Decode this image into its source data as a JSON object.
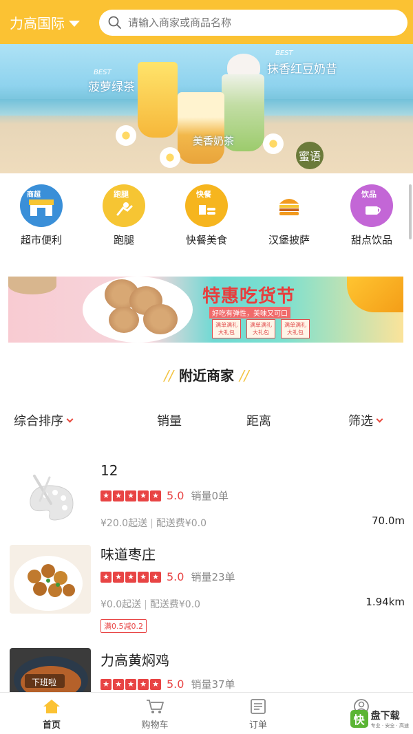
{
  "header": {
    "city": "力高国际",
    "search_placeholder": "请输入商家或商品名称"
  },
  "banner": {
    "texts": [
      "菠萝绿茶",
      "抹香红豆奶昔",
      "美香奶茶"
    ],
    "best_label": "BEST",
    "stamp": "蜜语"
  },
  "categories": [
    {
      "label": "超市便利",
      "icon": "store-icon",
      "tag": "商超",
      "color": "#3a8fd8"
    },
    {
      "label": "跑腿",
      "icon": "runner-icon",
      "tag": "跑腿",
      "color": "#f6c533"
    },
    {
      "label": "快餐美食",
      "icon": "fastfood-icon",
      "tag": "快餐",
      "color": "#f6b51e"
    },
    {
      "label": "汉堡披萨",
      "icon": "burger-icon",
      "tag": "",
      "color": "#f29a1e"
    },
    {
      "label": "甜点饮品",
      "icon": "drink-icon",
      "tag": "饮品",
      "color": "#c366d6"
    }
  ],
  "promo": {
    "title": "特惠吃货节",
    "subtitle": "好吃有弹性，美味又可口",
    "chips": [
      "满单满礼 大礼包",
      "满单满礼 大礼包",
      "满单满礼 大礼包"
    ]
  },
  "section": {
    "title": "附近商家",
    "decor": "//"
  },
  "sort": {
    "overall": "综合排序",
    "sales": "销量",
    "distance": "距离",
    "filter": "筛选"
  },
  "shops": [
    {
      "name": "12",
      "score": "5.0",
      "sales": "销量0单",
      "min_order": "¥20.0起送",
      "delivery_fee": "配送费¥0.0",
      "distance": "70.0m",
      "thumb": "palette-placeholder",
      "promo": ""
    },
    {
      "name": "味道枣庄",
      "score": "5.0",
      "sales": "销量23单",
      "min_order": "¥0.0起送",
      "delivery_fee": "配送费¥0.0",
      "distance": "1.94km",
      "thumb": "meatball-dish",
      "promo": "满0.5减0.2"
    },
    {
      "name": "力高黄焖鸡",
      "score": "5.0",
      "sales": "销量37单",
      "min_order": "",
      "delivery_fee": "",
      "distance": "",
      "thumb": "braised-chicken",
      "thumb_label": "下班啦",
      "promo": ""
    }
  ],
  "nav": [
    {
      "label": "首页",
      "icon": "home-icon",
      "active": true
    },
    {
      "label": "购物车",
      "icon": "cart-icon",
      "active": false
    },
    {
      "label": "订单",
      "icon": "order-icon",
      "active": false
    },
    {
      "label": "",
      "icon": "user-icon",
      "active": false
    }
  ],
  "watermark": {
    "logo": "快",
    "title": "盘下载",
    "subtitle": "专业 · 安全 · 高速"
  },
  "colors": {
    "brand": "#fbc233",
    "accent_red": "#e84444"
  }
}
